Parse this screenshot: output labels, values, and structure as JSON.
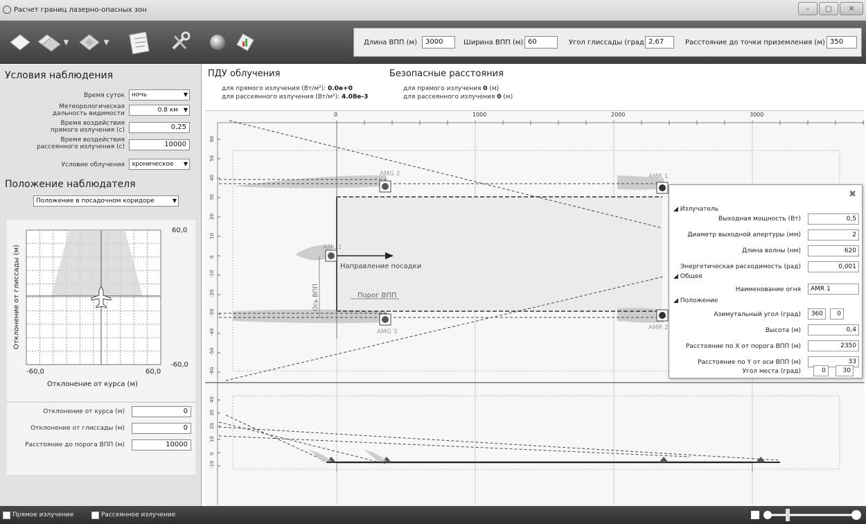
{
  "window": {
    "title": "Расчет границ лазерно-опасных зон",
    "min": "–",
    "max": "▢",
    "close": "✕"
  },
  "toolbar": {
    "icons": [
      "diamond-icon",
      "diamond-dropdown-icon",
      "diamond-dropdown-icon",
      "document-icon",
      "wrench-icon",
      "sphere-icon",
      "chart-icon"
    ]
  },
  "runway": {
    "length_label": "Длина ВПП (м)",
    "length": "3000",
    "width_label": "Ширина ВПП (м)",
    "width": "60",
    "glide_label": "Угол глиссады (град)",
    "glide": "2,67",
    "touch_label": "Расстояние до точки приземления (м)",
    "touch": "350"
  },
  "conditions": {
    "title": "Условия наблюдения",
    "time_label": "Время суток",
    "time": "ночь",
    "vis_label1": "Метеорологическая",
    "vis_label2": "дальность видимости",
    "vis": "0.8 км",
    "direct_label1": "Время воздействия",
    "direct_label2": "прямого излучения (с)",
    "direct": "0,25",
    "scat_label1": "Время воздействия",
    "scat_label2": "рассеянного излучения (с)",
    "scat": "10000",
    "cond_label": "Условие облучения",
    "cond": "хроническое"
  },
  "observer": {
    "title": "Положение наблюдателя",
    "mode": "Положение в посадочном коридоре",
    "y_top": "60,0",
    "y_bottom": "-60,0",
    "x_left": "-60,0",
    "x_right": "60,0",
    "x_axis": "Отклонение от курса (м)",
    "y_axis": "Отклонение от глиссады (м)",
    "dev_course_label": "Отклонение от курса (м)",
    "dev_course": "0",
    "dev_glide_label": "Отклонение от глиссады (м)",
    "dev_glide": "0",
    "dist_label": "Расстояние до порога ВПП (м)",
    "dist": "10000"
  },
  "dose": {
    "title": "ПДУ облучения",
    "direct_label": "для прямого излучения (Вт/м²): ",
    "direct": "0.0e+0",
    "scat_label": "для рассеянного излучения (Вт/м²): ",
    "scat": "4.08e-3"
  },
  "safe": {
    "title": "Безопасные расстояния",
    "direct_label": "для прямого излучения ",
    "direct": "0",
    "direct_unit": " (м)",
    "scat_label": "для рассеянного излучения ",
    "scat": "0",
    "scat_unit": " (м)"
  },
  "plot": {
    "x_ticks": [
      "0",
      "1000",
      "2000",
      "3000"
    ],
    "y_ticks": [
      "60",
      "50",
      "40",
      "30",
      "20",
      "10",
      "0",
      "-10",
      "-20",
      "-30",
      "-40",
      "-50",
      "-60"
    ],
    "y_ticks2": [
      "40",
      "30",
      "20",
      "10",
      "0",
      "-10"
    ],
    "lights": {
      "amg2": "AMG 2",
      "amr1": "AMR 1",
      "aml1": "AML 1",
      "amg3": "AMG 3",
      "amr2": "AMR 2"
    },
    "landing": "Направление посадки",
    "threshold": "Порог ВПП",
    "axis": "Ось ВПП"
  },
  "props": {
    "g1": "Излучатель",
    "power_label": "Выходная мощность (Вт)",
    "power": "0,5",
    "aperture_label": "Диаметр выходной апертуры (мм)",
    "aperture": "2",
    "wave_label": "Длина волны (нм)",
    "wave": "620",
    "div_label": "Энергетическая расходимость (рад)",
    "div": "0,001",
    "g2": "Общее",
    "name_label": "Наименование огня",
    "name": "AMR 1",
    "g3": "Положение",
    "az_label": "Азимутальный угол (град)",
    "az_deg": "360",
    "az_min": "0",
    "h_label": "Высота (м)",
    "h": "0,4",
    "x_label": "Расстояние по X от порога ВПП (м)",
    "x": "2350",
    "y_label": "Расстояние по Y от оси ВПП (м)",
    "y": "33",
    "el_label": "Угол места (град)",
    "el_deg": "0",
    "el_min": "30"
  },
  "status": {
    "direct": "Прямое излучение",
    "scat": "Рассеянное излучение"
  }
}
